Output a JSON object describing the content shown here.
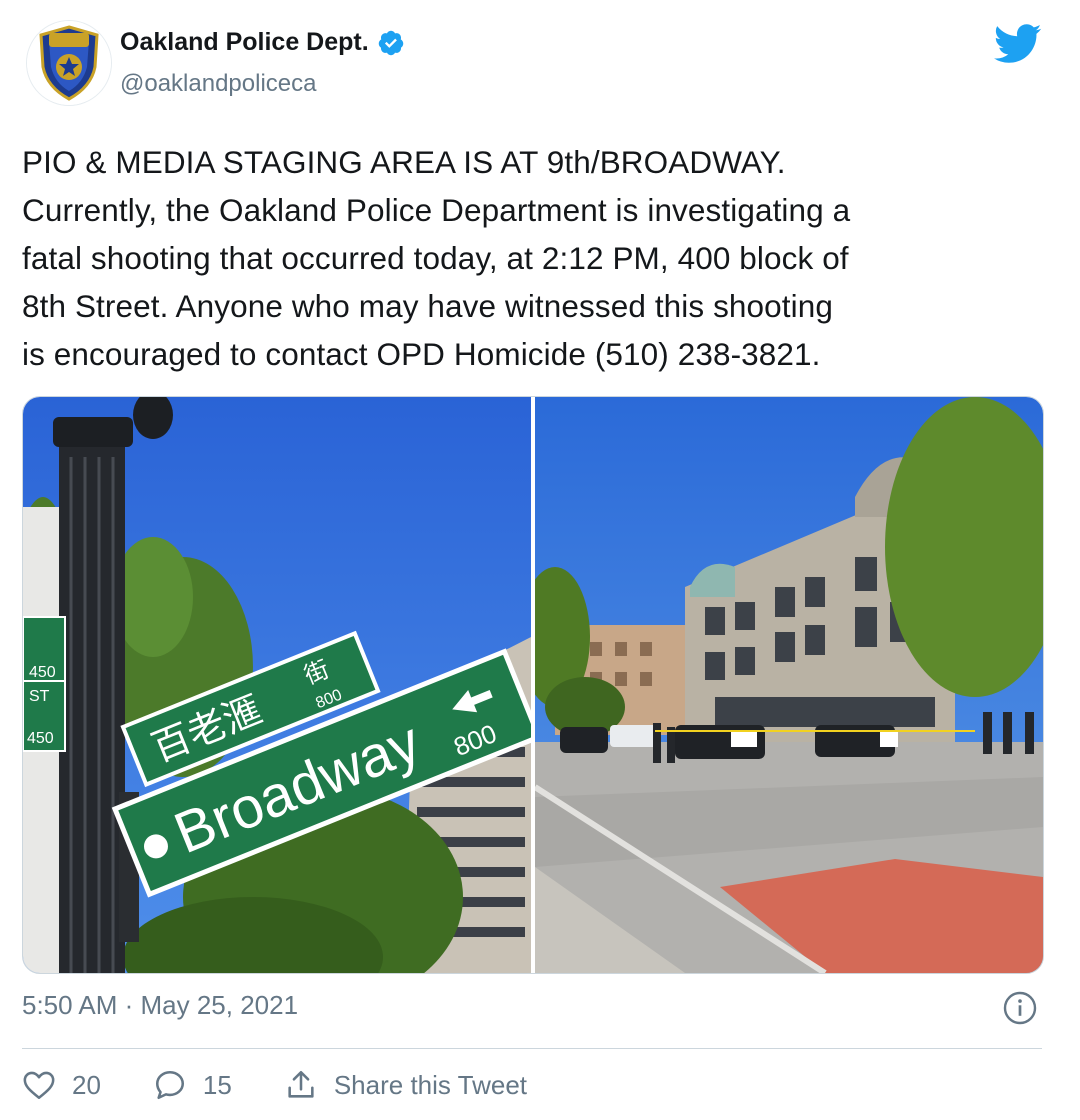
{
  "author": {
    "display_name": "Oakland Police Dept.",
    "handle": "@oaklandpoliceca",
    "verified_icon": "verified-badge-icon",
    "avatar_icon": "police-badge-icon"
  },
  "tweet": {
    "lines": [
      "PIO & MEDIA STAGING AREA IS AT 9th/BROADWAY.",
      "Currently, the Oakland Police Department is investigating a",
      "fatal shooting that occurred today, at 2:12 PM, 400 block of",
      "8th Street. Anyone who may have witnessed this shooting",
      "is encouraged to contact OPD Homicide (510) 238-3821."
    ]
  },
  "media": {
    "photo1": {
      "sign_main": "Broadway",
      "sign_main_number": "800",
      "sign_chinese": "百老滙",
      "sign_chinese_street": "街",
      "sign_chinese_number": "800",
      "side_sign_top_num": "450",
      "side_sign_st": "ST",
      "side_sign_bottom_num": "450"
    }
  },
  "meta": {
    "timestamp": "5:50 AM · May 25, 2021"
  },
  "actions": {
    "likes": "20",
    "replies": "15",
    "share_label": "Share this Tweet"
  },
  "colors": {
    "brand_blue": "#1da1f2",
    "text": "#14171a",
    "muted": "#657786",
    "sign_green": "#1f7a4a"
  }
}
